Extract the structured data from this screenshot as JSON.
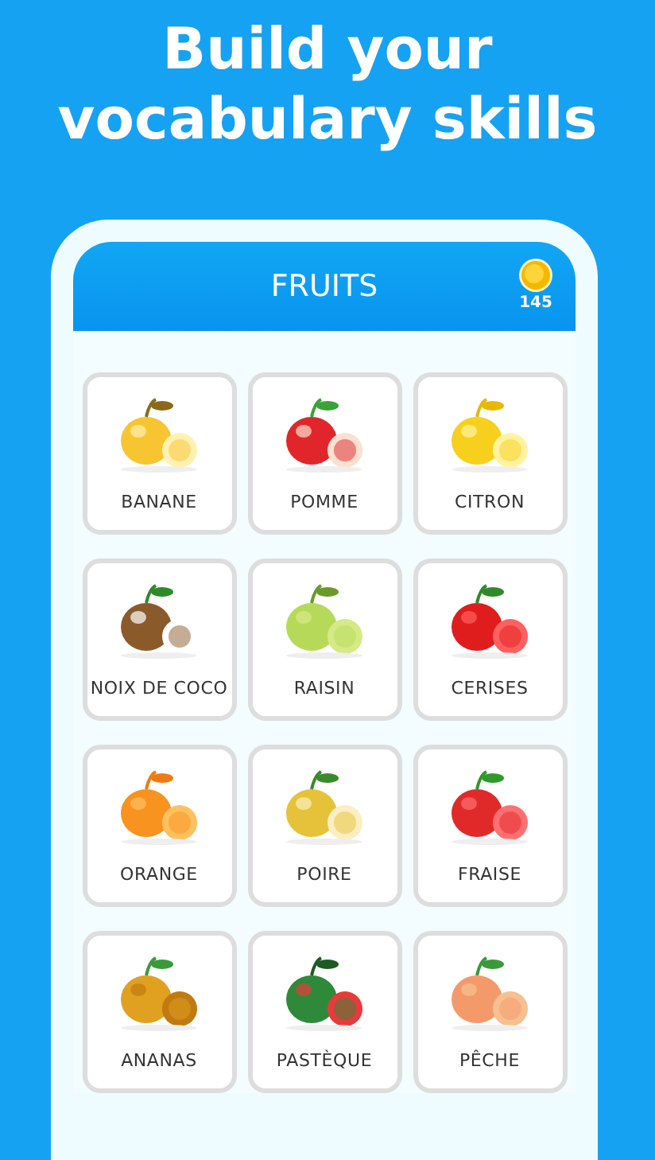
{
  "headline": "Build your vocabulary skills",
  "header": {
    "title": "FRUITS",
    "coins": "145"
  },
  "cards": [
    {
      "label": "BANANE",
      "kind": "picture"
    },
    {
      "label": "POMME",
      "kind": "picture"
    },
    {
      "label": "CITRON",
      "kind": "picture"
    },
    {
      "label": "NOIX DE COCO",
      "kind": "picture"
    },
    {
      "label": "RAISIN",
      "kind": "picture"
    },
    {
      "label": "CERISES",
      "kind": "picture"
    },
    {
      "label": "ORANGE",
      "kind": "picture"
    },
    {
      "label": "POIRE",
      "kind": "picture"
    },
    {
      "label": "FRAISE",
      "kind": "picture"
    },
    {
      "label": "ANANAS",
      "kind": "picture"
    },
    {
      "label": "PASTÈQUE",
      "kind": "picture"
    },
    {
      "label": "PÊCHE",
      "kind": "picture"
    }
  ]
}
